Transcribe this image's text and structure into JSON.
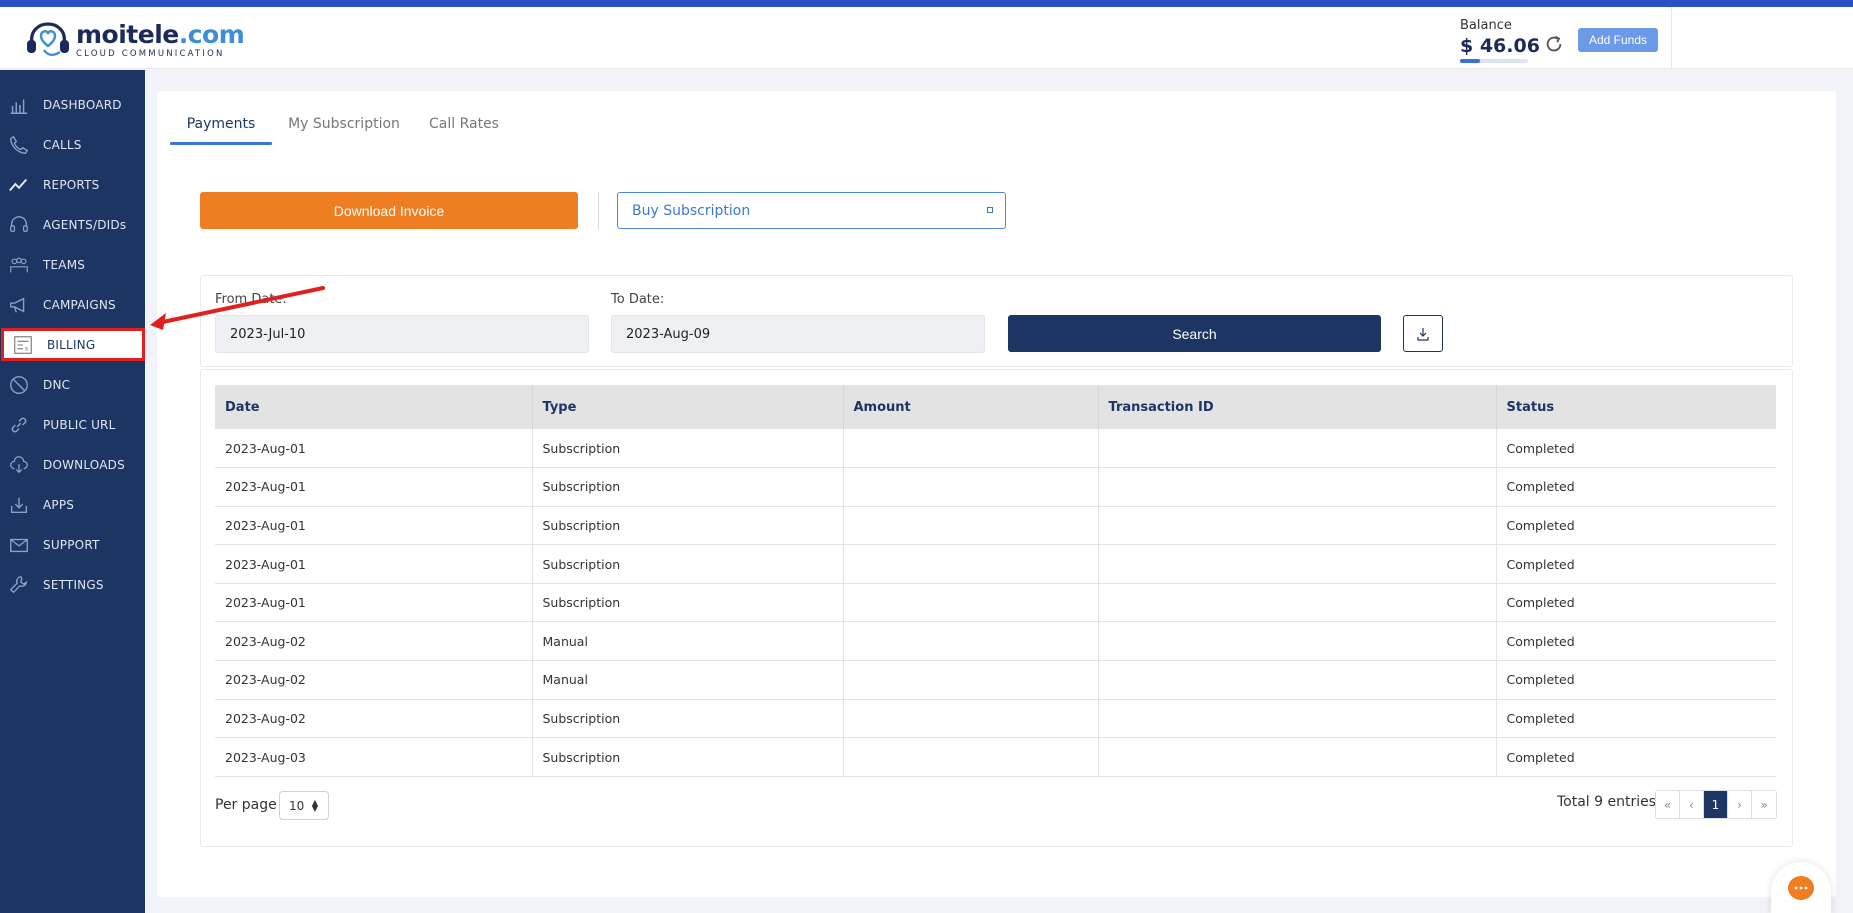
{
  "brand": {
    "name_main": "moitele",
    "name_tld": ".com",
    "tagline": "CLOUD COMMUNICATION"
  },
  "header": {
    "balance_label": "Balance",
    "balance_value": "$ 46.06",
    "add_funds_label": "Add Funds"
  },
  "sidebar": {
    "items": [
      {
        "label": "DASHBOARD",
        "icon": "dashboard-icon"
      },
      {
        "label": "CALLS",
        "icon": "phone-icon"
      },
      {
        "label": "REPORTS",
        "icon": "trend-icon"
      },
      {
        "label": "AGENTS/DIDs",
        "icon": "headset-icon"
      },
      {
        "label": "TEAMS",
        "icon": "team-icon"
      },
      {
        "label": "CAMPAIGNS",
        "icon": "megaphone-icon"
      },
      {
        "label": "BILLING",
        "icon": "invoice-icon",
        "active": true
      },
      {
        "label": "DNC",
        "icon": "block-icon"
      },
      {
        "label": "PUBLIC URL",
        "icon": "link-icon"
      },
      {
        "label": "DOWNLOADS",
        "icon": "cloud-download-icon"
      },
      {
        "label": "APPS",
        "icon": "apps-download-icon"
      },
      {
        "label": "SUPPORT",
        "icon": "mail-icon"
      },
      {
        "label": "SETTINGS",
        "icon": "wrench-icon"
      }
    ]
  },
  "tabs": [
    {
      "label": "Payments",
      "active": true
    },
    {
      "label": "My Subscription"
    },
    {
      "label": "Call Rates"
    }
  ],
  "actions": {
    "download_invoice_label": "Download Invoice",
    "buy_subscription_label": "Buy Subscription"
  },
  "filters": {
    "from_label": "From Date:",
    "from_value": "2023-Jul-10",
    "to_label": "To Date:",
    "to_value": "2023-Aug-09",
    "search_label": "Search"
  },
  "table": {
    "columns": [
      "Date",
      "Type",
      "Amount",
      "Transaction ID",
      "Status"
    ],
    "rows": [
      {
        "date": "2023-Aug-01",
        "type": "Subscription",
        "amount": "",
        "txn": "",
        "status": "Completed"
      },
      {
        "date": "2023-Aug-01",
        "type": "Subscription",
        "amount": "",
        "txn": "",
        "status": "Completed"
      },
      {
        "date": "2023-Aug-01",
        "type": "Subscription",
        "amount": "",
        "txn": "",
        "status": "Completed"
      },
      {
        "date": "2023-Aug-01",
        "type": "Subscription",
        "amount": "",
        "txn": "",
        "status": "Completed"
      },
      {
        "date": "2023-Aug-01",
        "type": "Subscription",
        "amount": "",
        "txn": "",
        "status": "Completed"
      },
      {
        "date": "2023-Aug-02",
        "type": "Manual",
        "amount": "",
        "txn": "",
        "status": "Completed"
      },
      {
        "date": "2023-Aug-02",
        "type": "Manual",
        "amount": "",
        "txn": "",
        "status": "Completed"
      },
      {
        "date": "2023-Aug-02",
        "type": "Subscription",
        "amount": "",
        "txn": "",
        "status": "Completed"
      },
      {
        "date": "2023-Aug-03",
        "type": "Subscription",
        "amount": "",
        "txn": "",
        "status": "Completed"
      }
    ]
  },
  "pagination": {
    "per_page_label": "Per page",
    "per_page_value": "10",
    "total_label": "Total 9 entries",
    "first": "«",
    "prev": "‹",
    "current": "1",
    "next": "›",
    "last": "»"
  },
  "colors": {
    "sidebar_bg": "#1d3563",
    "accent_orange": "#ef7d22",
    "accent_blue": "#3a78d8",
    "annotation_red": "#e0201d"
  }
}
